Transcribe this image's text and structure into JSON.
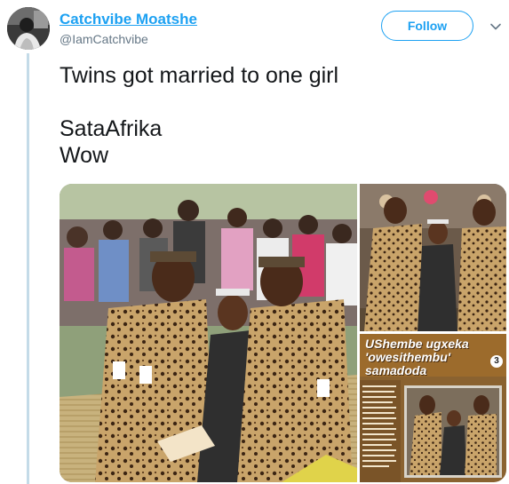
{
  "author": {
    "display_name": "Catchvibe Moatshe",
    "handle": "@IamCatchvibe"
  },
  "actions": {
    "follow_label": "Follow",
    "caret_icon": "chevron-down-icon"
  },
  "tweet": {
    "line1": "Twins got married to one girl",
    "line2": "SataAfrika",
    "line3": "Wow"
  },
  "media": {
    "clipping_headline": "UShembe ugxeka 'owesithembu' samadoda",
    "clipping_page_number": "3"
  },
  "colors": {
    "accent": "#1da1f2",
    "thread_line": "#c4dbe8",
    "secondary_text": "#657786"
  }
}
